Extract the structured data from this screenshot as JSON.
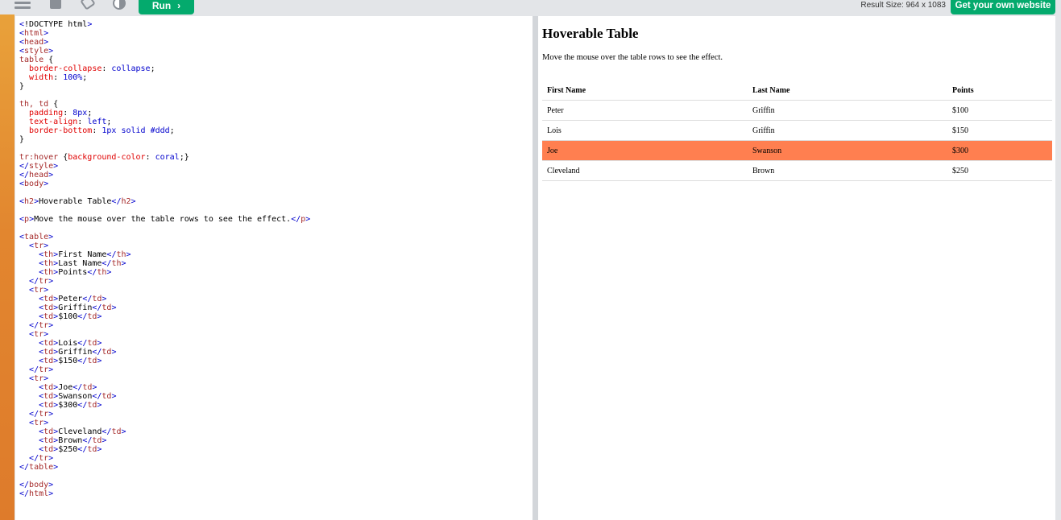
{
  "toolbar": {
    "run_label": "Run",
    "run_chevron": "›",
    "result_size": "Result Size: 964 x 1083",
    "own_site_label": "Get your own website"
  },
  "colors": {
    "accent": "#04aa6d",
    "hover_row": "#ff7f50",
    "border": "#dddddd"
  },
  "icons": [
    "menu-icon",
    "save-icon",
    "rotate-icon",
    "contrast-icon"
  ],
  "result": {
    "title": "Hoverable Table",
    "description": "Move the mouse over the table rows to see the effect.",
    "headers": [
      "First Name",
      "Last Name",
      "Points"
    ],
    "rows": [
      [
        "Peter",
        "Griffin",
        "$100"
      ],
      [
        "Lois",
        "Griffin",
        "$150"
      ],
      [
        "Joe",
        "Swanson",
        "$300"
      ],
      [
        "Cleveland",
        "Brown",
        "$250"
      ]
    ],
    "hovered_row": 2
  }
}
